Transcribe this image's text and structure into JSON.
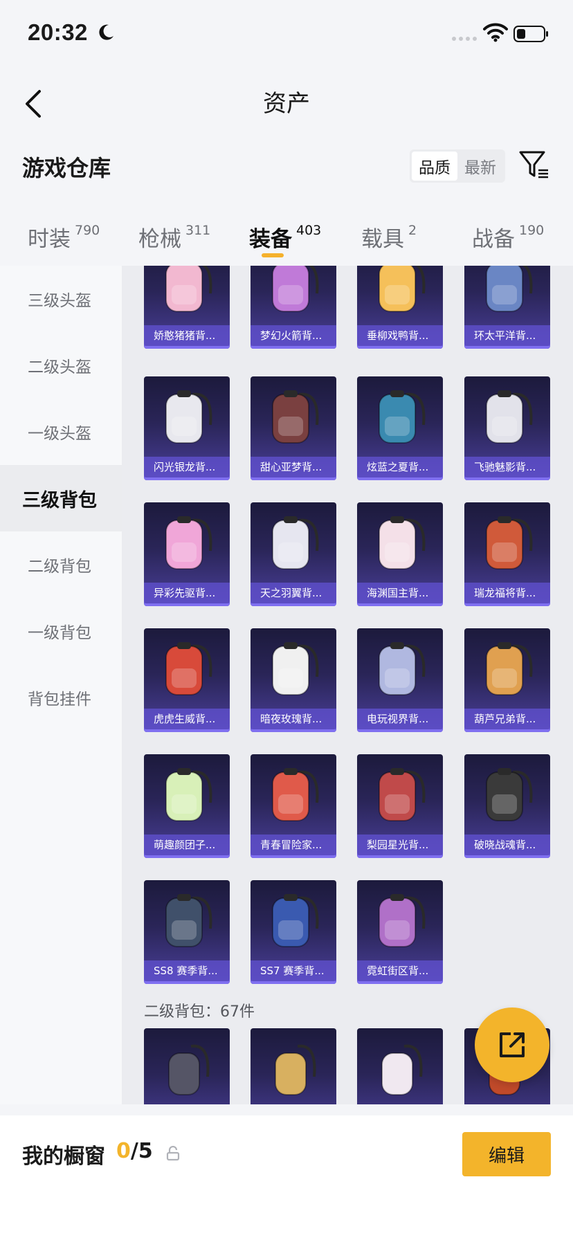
{
  "status_bar": {
    "time": "20:32"
  },
  "header": {
    "title": "资产"
  },
  "warehouse": {
    "title": "游戏仓库",
    "sort_options": [
      "品质",
      "最新"
    ],
    "active_sort": "品质"
  },
  "tabs": [
    {
      "label": "时装",
      "count": "790"
    },
    {
      "label": "枪械",
      "count": "311"
    },
    {
      "label": "装备",
      "count": "403",
      "active": true
    },
    {
      "label": "载具",
      "count": "2"
    },
    {
      "label": "战备",
      "count": "190"
    }
  ],
  "sidebar": {
    "items": [
      {
        "label": "三级头盔"
      },
      {
        "label": "二级头盔"
      },
      {
        "label": "一级头盔"
      },
      {
        "label": "三级背包",
        "active": true
      },
      {
        "label": "二级背包"
      },
      {
        "label": "一级背包"
      },
      {
        "label": "背包挂件"
      }
    ]
  },
  "grid": {
    "items": [
      "娇憨猪猪背...",
      "梦幻火箭背...",
      "垂柳戏鸭背...",
      "环太平洋背...",
      "闪光银龙背...",
      "甜心亚梦背...",
      "炫蓝之夏背...",
      "飞驰魅影背...",
      "异彩先驱背...",
      "天之羽翼背...",
      "海渊国主背...",
      "瑞龙福将背...",
      "虎虎生威背...",
      "暗夜玫瑰背...",
      "电玩视界背...",
      "葫芦兄弟背...",
      "萌趣颜团子...",
      "青春冒险家...",
      "梨园星光背...",
      "破晓战魂背...",
      "SS8 赛季背...",
      "SS7 赛季背...",
      "霓虹街区背..."
    ],
    "section_label": "二级背包：67件"
  },
  "bottom_bar": {
    "window_label": "我的橱窗",
    "current": "0",
    "total": "/5",
    "edit_label": "编辑"
  },
  "colors": {
    "accent": "#f3b42b",
    "card_bottom": "#4a3f9a",
    "card_label_bg": "#6252d2"
  }
}
